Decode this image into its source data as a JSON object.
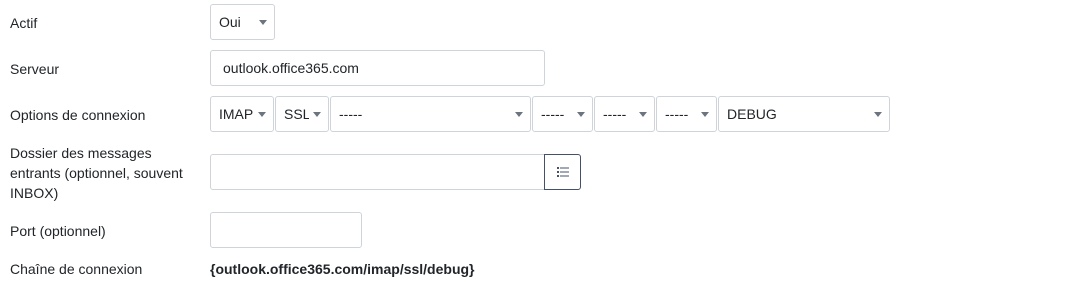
{
  "fields": {
    "actif": {
      "label": "Actif",
      "value": "Oui"
    },
    "serveur": {
      "label": "Serveur",
      "value": "outlook.office365.com"
    },
    "options": {
      "label": "Options de connexion",
      "protocol": "IMAP",
      "security": "SSL",
      "opt1": "-----",
      "opt2": "-----",
      "opt3": "-----",
      "opt4": "-----",
      "debug": "DEBUG"
    },
    "dossier": {
      "label_lines": [
        "Dossier des messages",
        "entrants (optionnel, souvent",
        "INBOX)"
      ],
      "value": "",
      "list_icon": "list-icon"
    },
    "port": {
      "label": "Port (optionnel)",
      "value": ""
    },
    "chaine": {
      "label": "Chaîne de connexion",
      "value": "{outlook.office365.com/imap/ssl/debug}"
    }
  }
}
